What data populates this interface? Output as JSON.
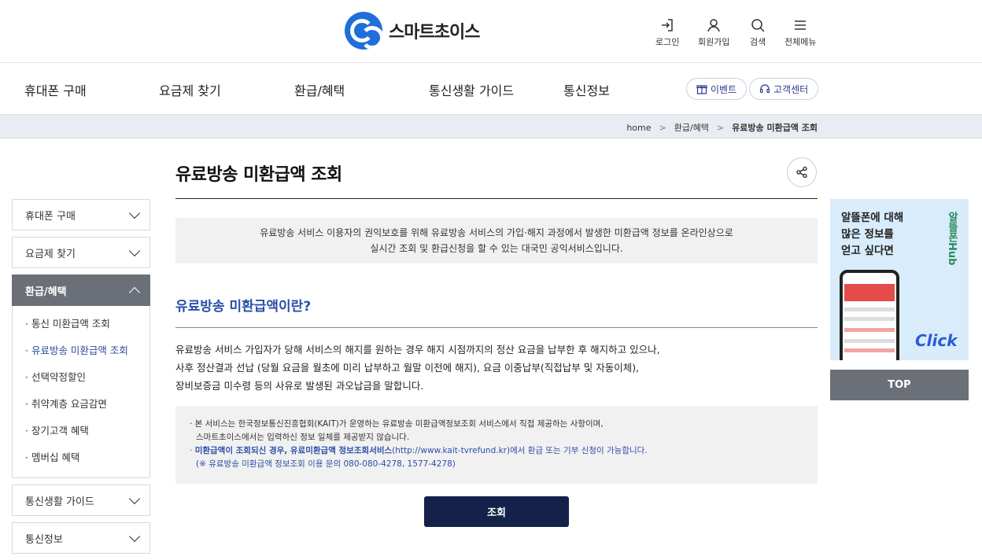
{
  "brand": {
    "name": "스마트초이스"
  },
  "utility": [
    {
      "label": "로그인",
      "icon": "login-icon"
    },
    {
      "label": "회원가입",
      "icon": "user-icon"
    },
    {
      "label": "검색",
      "icon": "search-icon"
    },
    {
      "label": "전체메뉴",
      "icon": "menu-icon"
    }
  ],
  "gnb": {
    "items": [
      "휴대폰 구매",
      "요금제 찾기",
      "환급/혜택",
      "통신생활 가이드",
      "통신정보"
    ],
    "event_label": "이벤트",
    "support_label": "고객센터"
  },
  "breadcrumb": {
    "home": "home",
    "section": "환급/혜택",
    "current": "유료방송 미환급액 조회"
  },
  "sidebar": {
    "groups": [
      {
        "label": "휴대폰 구매"
      },
      {
        "label": "요금제 찾기"
      },
      {
        "label": "환급/혜택"
      },
      {
        "label": "통신생활 가이드"
      },
      {
        "label": "통신정보"
      }
    ],
    "sub_items": [
      "· 통신 미환급액 조회",
      "· 유료방송 미환급액 조회",
      "· 선택약정할인",
      "· 취약계층 요금감면",
      "· 장기고객 혜택",
      "· 멤버십 혜택"
    ]
  },
  "main": {
    "title": "유료방송 미환급액 조회",
    "intro_line1": "유료방송 서비스 이용자의 권익보호를 위해 유료방송 서비스의 가입·해지 과정에서 발생한 미환급액 정보를 온라인상으로",
    "intro_line2": "실시간 조회 및 환급신청을 할 수 있는 대국민 공익서비스입니다.",
    "section_title": "유료방송 미환급액이란?",
    "desc_line1": "유료방송 서비스 가입자가 당해 서비스의 해지를 원하는 경우 해지 시점까지의 정산 요금을 납부한 후 해지하고 있으나,",
    "desc_line2": "사후 정산결과 선납 (당월 요금을 월초에 미리 납부하고 월말 이전에 해지), 요금 이중납부(직접납부 및 자동이체),",
    "desc_line3": "장비보증금 미수령 등의 사유로 발생된 과오납금을 말합니다.",
    "notice_line1": "· 본 서비스는 한국정보통신진흥협회(KAIT)가 운영하는 유료방송 미환급액정보조회 서비스에서 직접 제공하는 사항이며,",
    "notice_line2": "스마트초이스에서는 입력하신 정보 일체를 제공받지 않습니다.",
    "notice_line3_bold": "미환급액이 조회되신 경우, 유료미환급액 정보조회서비스",
    "notice_line3_rest": "(http://www.kait-tvrefund.kr)에서 환급 또는 기부 신청이 가능합니다.",
    "notice_line4": "(※ 유료방송 미환급액 정보조회 이용 문의 080-080-4278, 1577-4278)",
    "button_label": "조회"
  },
  "banner": {
    "line1": "알뜰폰에 대해",
    "line2": "많은 정보를",
    "line3": "얻고 싶다면",
    "brand": "알뜰폰Hub",
    "click": "Click"
  },
  "top_button": "TOP"
}
